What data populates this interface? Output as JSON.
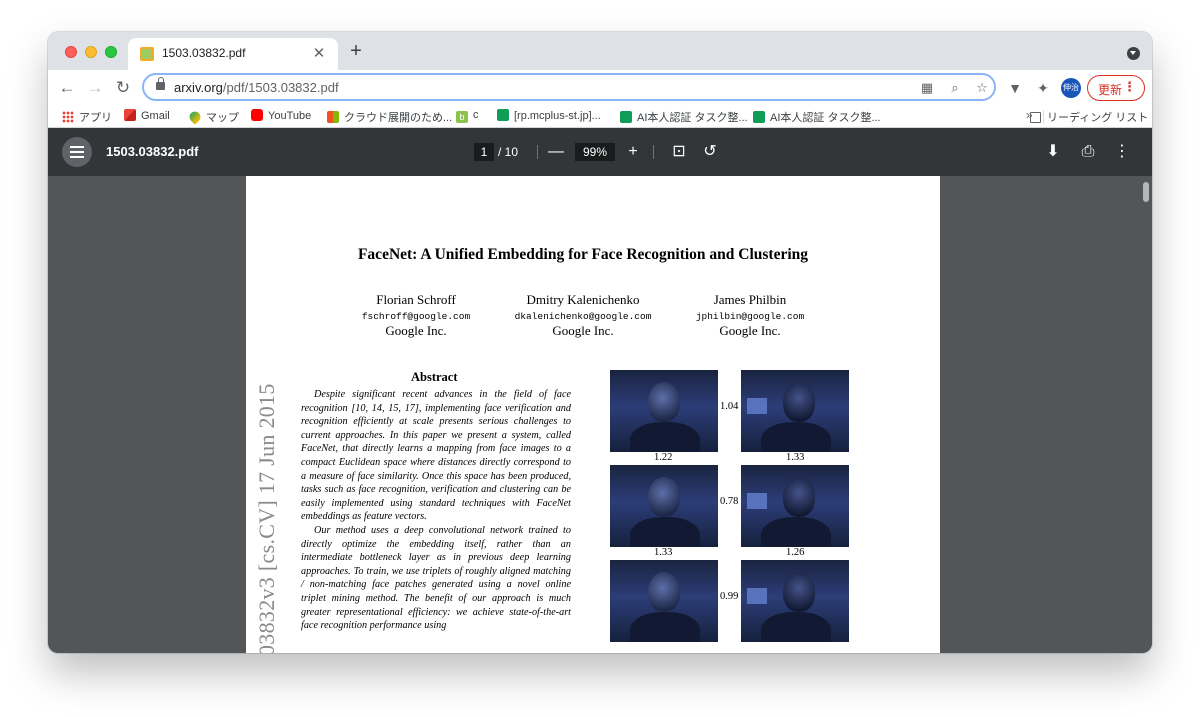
{
  "browser": {
    "tab": {
      "title": "1503.03832.pdf",
      "close": "✕"
    },
    "new_tab": "+",
    "nav": {
      "back": "←",
      "forward": "→",
      "reload": "↻"
    },
    "address": {
      "host": "arxiv.org",
      "path": "/pdf/1503.03832.pdf"
    },
    "omnibox_icons": {
      "qr": "▦",
      "zoom": "⌕",
      "star": "☆"
    },
    "extensions": {
      "ext1": "▼",
      "puzzle": "✦"
    },
    "profile_initials": "伸治",
    "update": {
      "label": "更新",
      "menu": "⋮"
    }
  },
  "bookmarks": {
    "items": [
      {
        "label": "アプリ",
        "icon": "apps-grid-icon"
      },
      {
        "label": "Gmail",
        "icon": "gmail-icon"
      },
      {
        "label": "マップ",
        "icon": "maps-icon"
      },
      {
        "label": "YouTube",
        "icon": "youtube-icon"
      },
      {
        "label": "クラウド展開のため...",
        "icon": "microsoft-icon"
      },
      {
        "label": "c",
        "icon": "b-icon"
      },
      {
        "label": "[rp.mcplus-st.jp]...",
        "icon": "sheets-icon"
      },
      {
        "label": "AI本人認証 タスク整...",
        "icon": "sheets-icon"
      },
      {
        "label": "AI本人認証 タスク整...",
        "icon": "sheets-icon"
      }
    ],
    "overflow": "»",
    "reading_list": "リーディング リスト"
  },
  "pdf_viewer": {
    "title": "1503.03832.pdf",
    "page_current": "1",
    "page_total": "/ 10",
    "zoom_out": "—",
    "zoom": "99%",
    "zoom_in": "+",
    "icons": {
      "fit": "⊡",
      "rotate": "↺",
      "download": "⬇",
      "print": "⎙",
      "more": "⋮"
    }
  },
  "paper": {
    "title": "FaceNet: A Unified Embedding for Face Recognition and Clustering",
    "authors": [
      {
        "name": "Florian Schroff",
        "email": "fschroff@google.com",
        "affiliation": "Google Inc."
      },
      {
        "name": "Dmitry Kalenichenko",
        "email": "dkalenichenko@google.com",
        "affiliation": "Google Inc."
      },
      {
        "name": "James Philbin",
        "email": "jphilbin@google.com",
        "affiliation": "Google Inc."
      }
    ],
    "arxiv_stamp": "03832v3   [cs.CV]   17 Jun 2015",
    "abstract_heading": "Abstract",
    "abstract_p1": "Despite significant recent advances in the field of face recognition [10, 14, 15, 17], implementing face verification and recognition efficiently at scale presents serious challenges to current approaches. In this paper we present a system, called FaceNet, that directly learns a mapping from face images to a compact Euclidean space where distances directly correspond to a measure of face similarity. Once this space has been produced, tasks such as face recognition, verification and clustering can be easily implemented using standard techniques with FaceNet embeddings as feature vectors.",
    "abstract_p2": "Our method uses a deep convolutional network trained to directly optimize the embedding itself, rather than an intermediate bottleneck layer as in previous deep learning approaches. To train, we use triplets of roughly aligned matching / non-matching face patches generated using a novel online triplet mining method. The benefit of our approach is much greater representational efficiency: we achieve state-of-the-art face recognition performance using",
    "figure_distances": {
      "row1_between": "1.04",
      "row1_left": "1.22",
      "row1_right": "1.33",
      "row2_between": "0.78",
      "row2_left": "1.33",
      "row2_right": "1.26",
      "row3_between": "0.99"
    }
  }
}
